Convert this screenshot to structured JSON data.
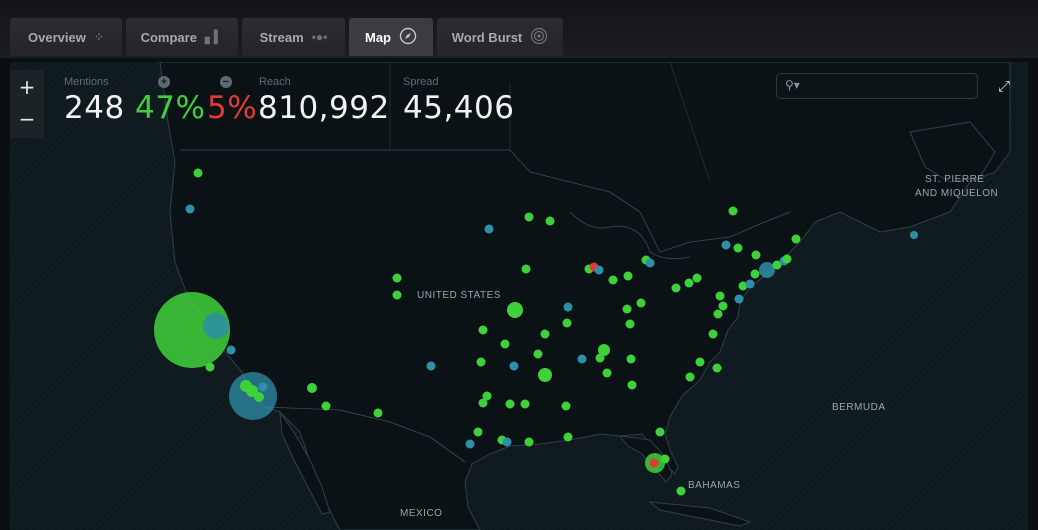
{
  "tabs": [
    {
      "label": "Overview",
      "icon": "overview-icon",
      "active": false
    },
    {
      "label": "Compare",
      "icon": "bar-chart-icon",
      "active": false
    },
    {
      "label": "Stream",
      "icon": "stream-icon",
      "active": false
    },
    {
      "label": "Map",
      "icon": "compass-icon",
      "active": true
    },
    {
      "label": "Word Burst",
      "icon": "burst-icon",
      "active": false
    }
  ],
  "zoom": {
    "in": "+",
    "out": "−"
  },
  "stats": {
    "mentions_label": "Mentions",
    "mentions": "248",
    "positive": "47%",
    "negative": "5%",
    "reach_label": "Reach",
    "reach": "810,992",
    "spread_label": "Spread",
    "spread": "45,406"
  },
  "colors": {
    "positive": "#3fd13a",
    "negative": "#e03b35",
    "neutral": "#2d8fa8",
    "background": "#0b0f12"
  },
  "labels": {
    "united_states": "UNITED STATES",
    "st_pierre": "ST. PIERRE",
    "and_miquelon": "AND MIQUELON",
    "bermuda": "BERMUDA",
    "bahamas": "BAHAMAS",
    "mexico": "MEXICO"
  },
  "search": {
    "placeholder": ""
  }
}
